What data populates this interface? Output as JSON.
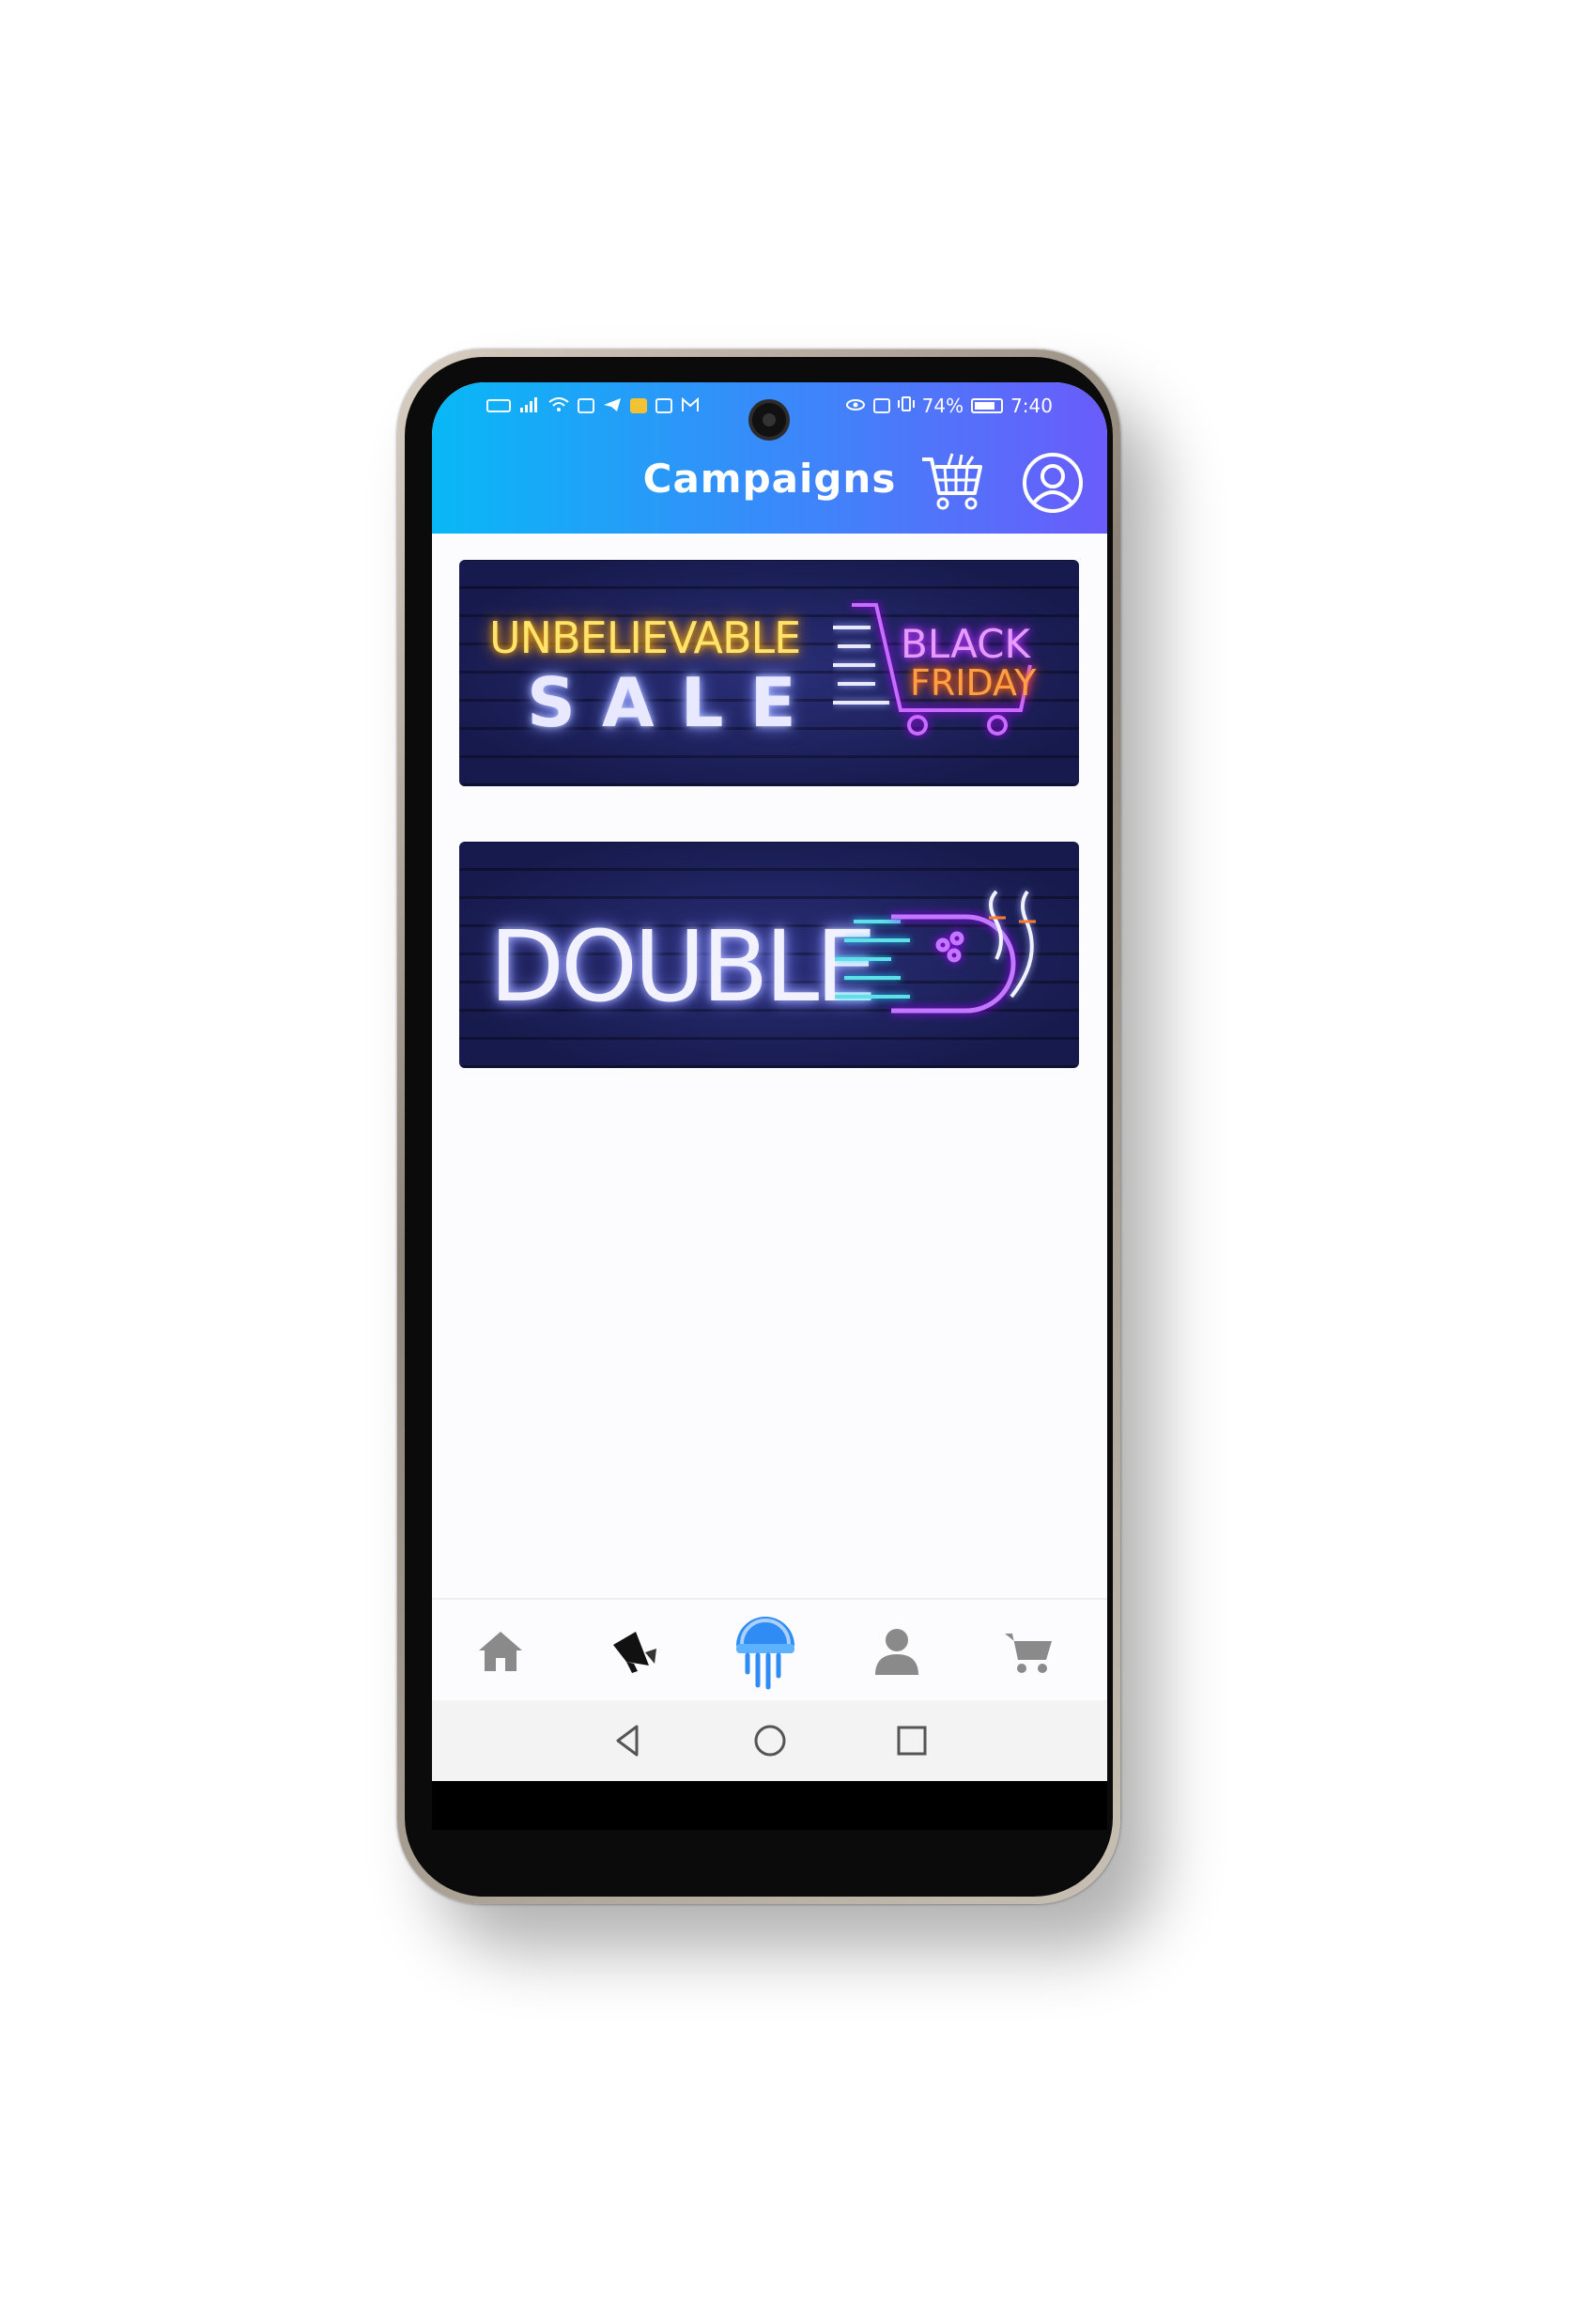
{
  "status_bar": {
    "left_icons": [
      "volte-icon",
      "signal-icon",
      "wifi-icon",
      "notification-icon",
      "telegram-icon",
      "app-icon",
      "image-icon",
      "gmail-icon"
    ],
    "right_icons": [
      "eye-icon",
      "nfc-icon",
      "vibrate-icon"
    ],
    "battery": "74%",
    "time": "7:40"
  },
  "header": {
    "title": "Campaigns",
    "cart_icon": "cart-icon",
    "profile_icon": "user-circle-icon"
  },
  "banners": [
    {
      "name": "black-friday-banner",
      "lines": [
        "UNBELIEVABLE",
        "SALE",
        "BLACK",
        "FRIDAY"
      ]
    },
    {
      "name": "double-banner",
      "lines": [
        "DOUBLE"
      ]
    }
  ],
  "bottom_nav": {
    "items": [
      {
        "icon": "home-icon",
        "active": false
      },
      {
        "icon": "megaphone-icon",
        "active": false
      },
      {
        "icon": "jellyfish-icon",
        "active": true
      },
      {
        "icon": "person-icon",
        "active": false
      },
      {
        "icon": "cart-icon",
        "active": false
      }
    ]
  },
  "system_nav": [
    "back-icon",
    "home-circle-icon",
    "recents-icon"
  ],
  "colors": {
    "appbar_gradient": [
      "#08b8f6",
      "#3d86fa",
      "#6a5cfb"
    ],
    "nav_inactive": "#8a8a8a",
    "nav_active": "#2f8cf5"
  }
}
